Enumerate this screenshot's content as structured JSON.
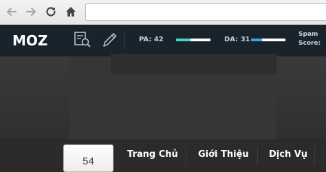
{
  "browser": {
    "icons": [
      "back-arrow-icon",
      "forward-arrow-icon",
      "reload-icon",
      "home-icon"
    ],
    "address": ""
  },
  "moz_toolbar": {
    "logo": "MOZ",
    "page_analysis_icon": "page-analysis-icon",
    "highlight_icon": "pencil-icon",
    "pa": {
      "label": "PA: 42",
      "value": 42,
      "bar_color": "#4fd1c5"
    },
    "da": {
      "label": "DA: 31",
      "value": 31,
      "bar_color": "#3aa3e3"
    },
    "spam": {
      "line1": "Spam",
      "line2": "Score:"
    }
  },
  "page": {
    "counter": "54",
    "menu": [
      "Trang Chủ",
      "Giới Thiệu",
      "Dịch Vụ"
    ]
  },
  "colors": {
    "moz_bar": "#19232b",
    "menu_bar": "#2b2b2b"
  }
}
